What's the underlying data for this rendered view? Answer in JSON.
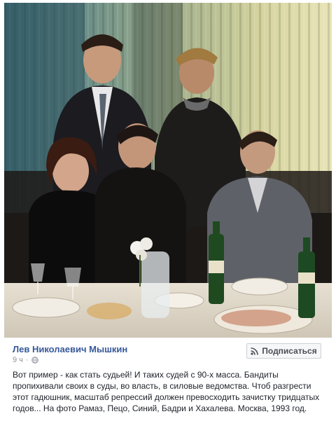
{
  "post": {
    "author_name": "Лев Николаевич Мышкин",
    "timestamp": "9 ч",
    "privacy_icon": "globe-icon",
    "subscribe_label": "Подписаться",
    "subscribe_icon": "rss-icon",
    "text": "Вот пример - как стать судьей! И таких судей с 90-х масса. Бандиты пропихивали своих в суды, во власть, в силовые ведомства. Чтоб разгрести этот гадюшник, масштаб репрессий должен превосходить зачистку тридцатых годов... На фото Рамаз, Пецо, Синий, Бадри и Хахалева. Москва, 1993 год."
  },
  "colors": {
    "author_link": "#365899",
    "meta_gray": "#90949c",
    "body_text": "#1d2129",
    "button_bg": "#f6f7f9",
    "button_border": "#ccd0d5"
  }
}
